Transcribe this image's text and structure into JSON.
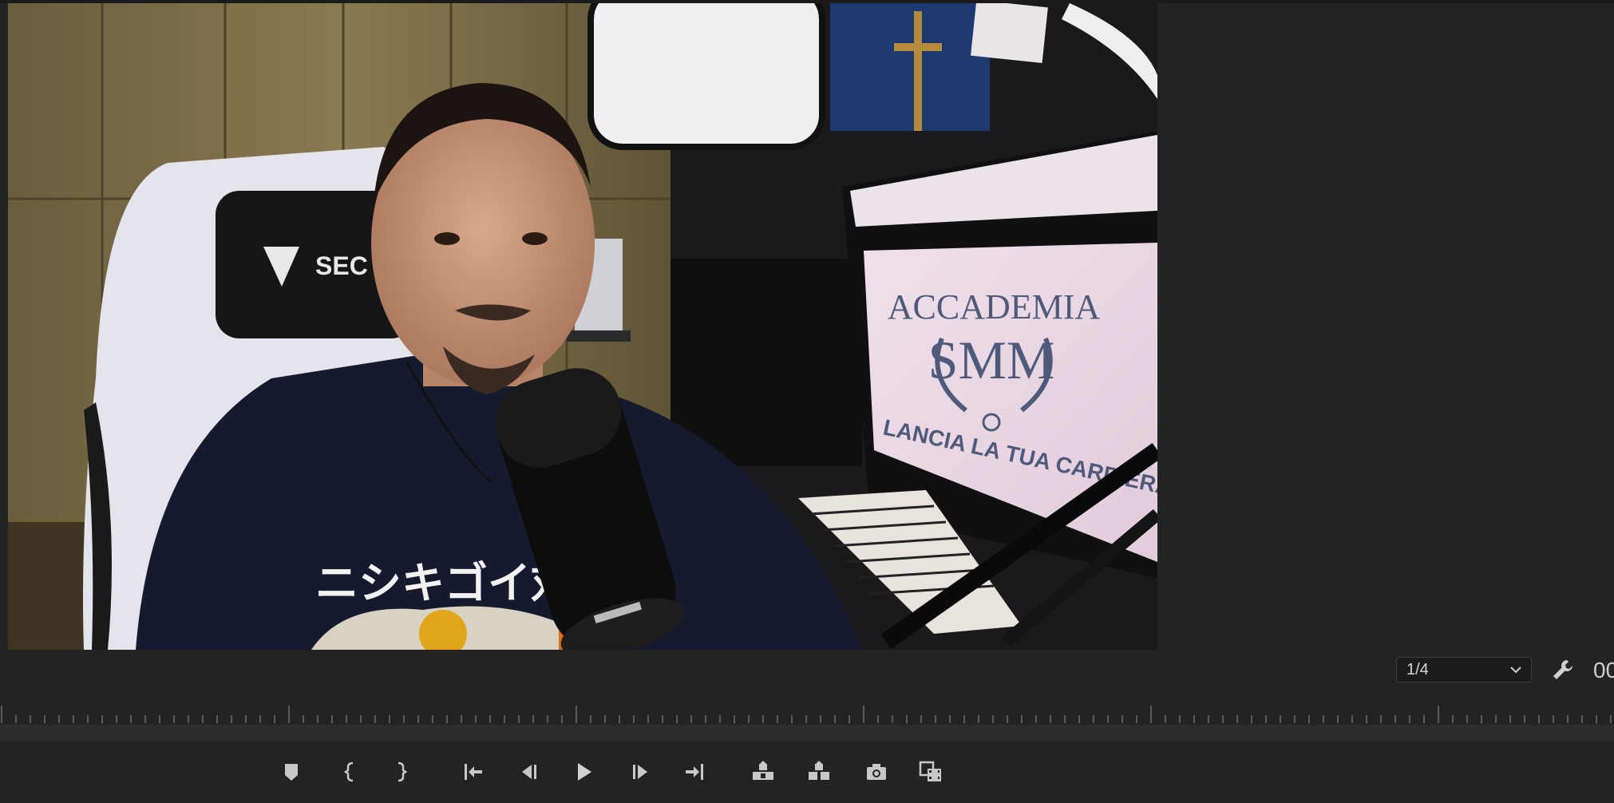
{
  "program_monitor": {
    "resolution": {
      "selected": "1/4"
    },
    "timecode": "00"
  },
  "video_frame": {
    "screen_title_line1": "ACCADEMIA",
    "screen_title_line2": "SMM",
    "screen_tagline": "LANCIA LA TUA CARRIERA DIGITALE",
    "shirt_text": "ニシキゴイ対策",
    "chair_brand": "SEC"
  },
  "transport_controls": [
    {
      "name": "add-marker",
      "icon": "marker-icon"
    },
    {
      "name": "mark-in",
      "icon": "mark-in-icon"
    },
    {
      "name": "mark-out",
      "icon": "mark-out-icon"
    },
    {
      "name": "go-to-in",
      "icon": "go-to-in-icon"
    },
    {
      "name": "step-back",
      "icon": "step-back-icon"
    },
    {
      "name": "play",
      "icon": "play-icon"
    },
    {
      "name": "step-forward",
      "icon": "step-forward-icon"
    },
    {
      "name": "go-to-out",
      "icon": "go-to-out-icon"
    },
    {
      "name": "lift",
      "icon": "lift-icon"
    },
    {
      "name": "extract",
      "icon": "extract-icon"
    },
    {
      "name": "export-frame",
      "icon": "camera-icon"
    },
    {
      "name": "compare-view",
      "icon": "compare-view-icon"
    }
  ],
  "colors": {
    "panel_bg": "#232323",
    "icon": "#c8c8c8",
    "ruler_tick": "#5a5a5a"
  }
}
